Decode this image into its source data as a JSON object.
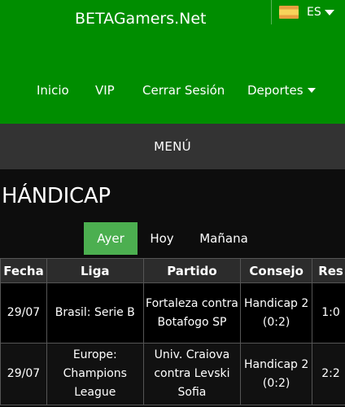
{
  "header": {
    "brand": "BETAGamers.Net",
    "language": {
      "code": "ES",
      "flag": "spain-flag-icon"
    },
    "nav": [
      {
        "label": "Inicio"
      },
      {
        "label": "VIP"
      },
      {
        "label": "Cerrar Sesión"
      },
      {
        "label": "Deportes"
      }
    ]
  },
  "menu": {
    "label": "MENÚ"
  },
  "page": {
    "title": "HÁNDICAP"
  },
  "tabs": [
    {
      "label": "Ayer",
      "active": true
    },
    {
      "label": "Hoy",
      "active": false
    },
    {
      "label": "Mañana",
      "active": false
    }
  ],
  "table": {
    "headers": [
      "Fecha",
      "Liga",
      "Partido",
      "Consejo",
      "Res"
    ],
    "rows": [
      {
        "fecha": "29/07",
        "liga": "Brasil: Serie B",
        "partido": "Fortaleza contra Botafogo SP",
        "consejo": "Handicap 2 (0:2)",
        "res": "1:0"
      },
      {
        "fecha": "29/07",
        "liga": "Europe: Champions League",
        "partido": "Univ. Craiova contra Levski Sofia",
        "consejo": "Handicap 2 (0:2)",
        "res": "2:2"
      }
    ]
  },
  "colors": {
    "header_bg": "#008d00",
    "menu_bg": "#333333",
    "active_tab": "#4caf50",
    "page_bg": "#0d0d0d"
  }
}
